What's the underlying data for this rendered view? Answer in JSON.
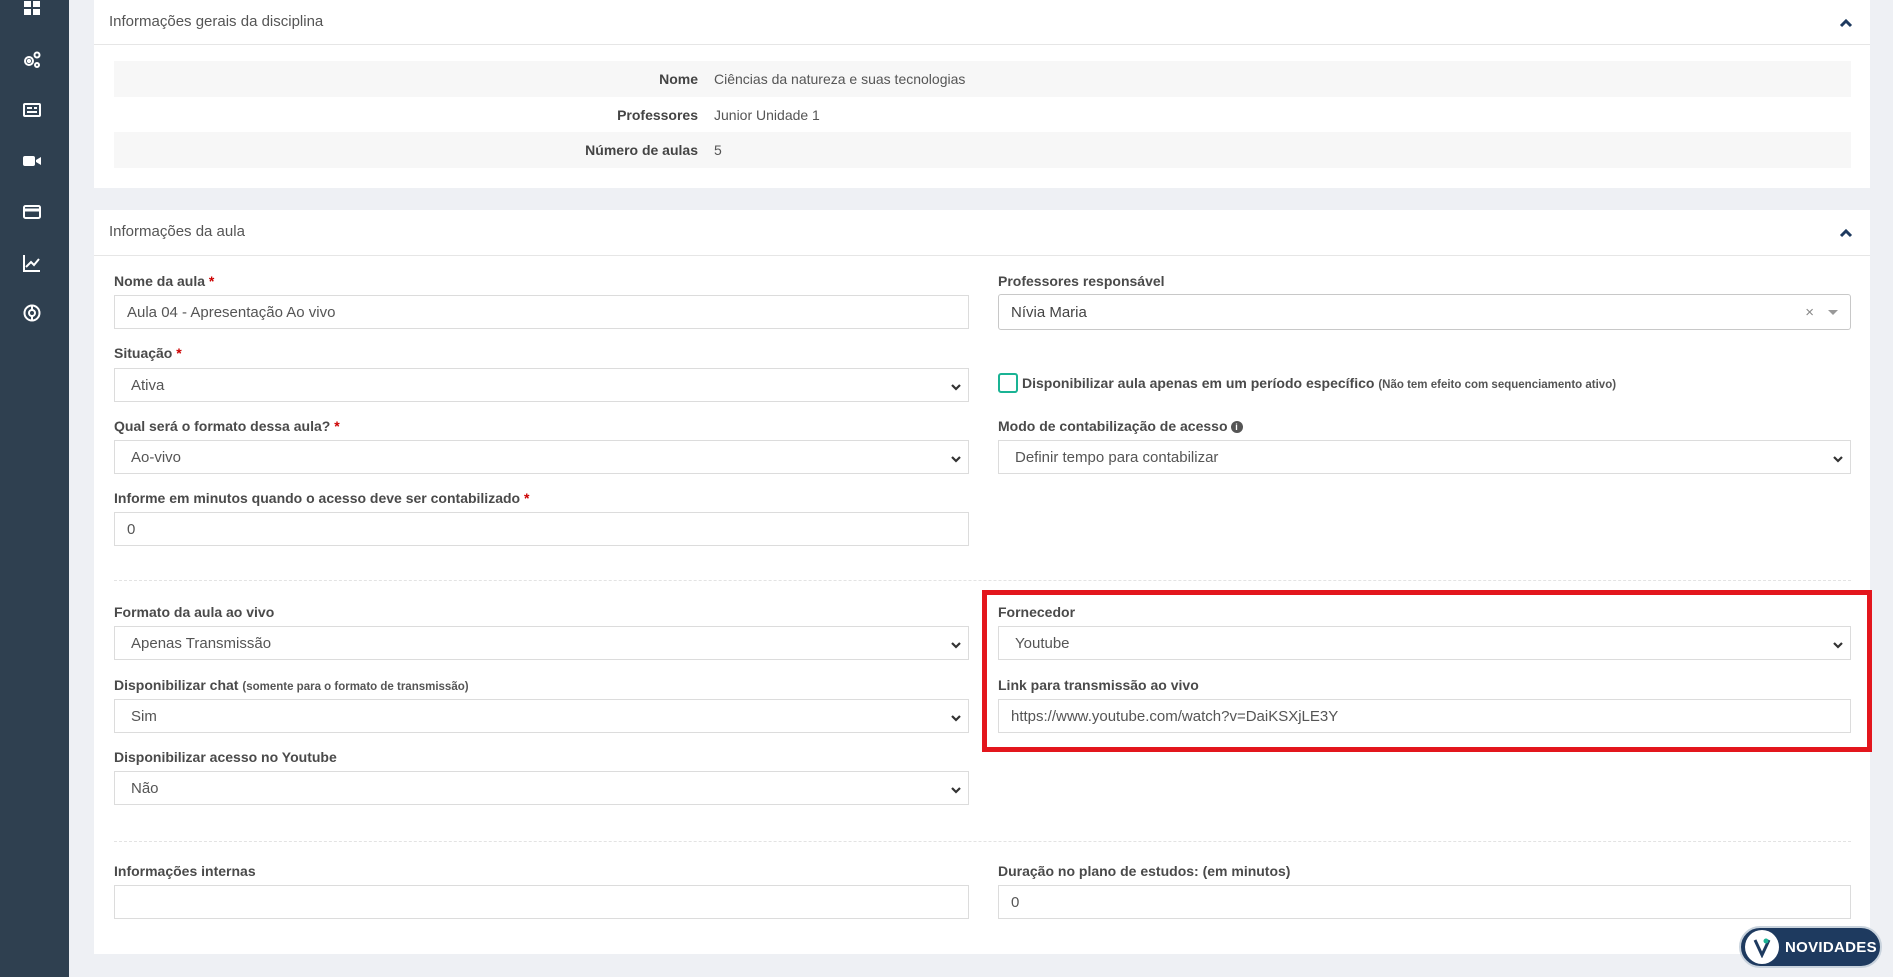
{
  "sidebar": {
    "icons": [
      "dashboard-icon",
      "gears-icon",
      "newspaper-icon",
      "video-icon",
      "credit-card-icon",
      "chart-line-icon",
      "lifebuoy-icon"
    ]
  },
  "panel_general": {
    "title": "Informações gerais da disciplina",
    "rows": [
      {
        "label": "Nome",
        "value": "Ciências da natureza e suas tecnologias"
      },
      {
        "label": "Professores",
        "value": "Junior Unidade 1"
      },
      {
        "label": "Número de aulas",
        "value": "5"
      }
    ]
  },
  "panel_lesson": {
    "title": "Informações da aula",
    "required_mark": "*",
    "nome_aula": {
      "label": "Nome da aula",
      "value": "Aula 04 - Apresentação Ao vivo"
    },
    "professores": {
      "label": "Professores responsável",
      "value": "Nívia Maria",
      "clear": "×"
    },
    "situacao": {
      "label": "Situação",
      "value": "Ativa"
    },
    "periodo": {
      "label": "Disponibilizar aula apenas em um período específico",
      "hint": "(Não tem efeito com sequenciamento ativo)",
      "checked": false
    },
    "formato": {
      "label": "Qual será o formato dessa aula?",
      "value": "Ao-vivo"
    },
    "modo": {
      "label": "Modo de contabilização de acesso",
      "info": "i",
      "value": "Definir tempo para contabilizar"
    },
    "minutos": {
      "label": "Informe em minutos quando o acesso deve ser contabilizado",
      "value": "0"
    },
    "formato_ao_vivo": {
      "label": "Formato da aula ao vivo",
      "value": "Apenas Transmissão"
    },
    "fornecedor": {
      "label": "Fornecedor",
      "value": "Youtube"
    },
    "chat": {
      "label": "Disponibilizar chat",
      "hint": "(somente para o formato de transmissão)",
      "value": "Sim"
    },
    "link": {
      "label": "Link para transmissão ao vivo",
      "value": "https://www.youtube.com/watch?v=DaiKSXjLE3Y"
    },
    "youtube_acesso": {
      "label": "Disponibilizar acesso no Youtube",
      "value": "Não"
    },
    "info_internas": {
      "label": "Informações internas",
      "value": ""
    },
    "duracao": {
      "label": "Duração no plano de estudos: (em minutos)",
      "value": "0"
    }
  },
  "highlight_color": "#e3161d",
  "novidades": {
    "label": "NOVIDADES"
  }
}
